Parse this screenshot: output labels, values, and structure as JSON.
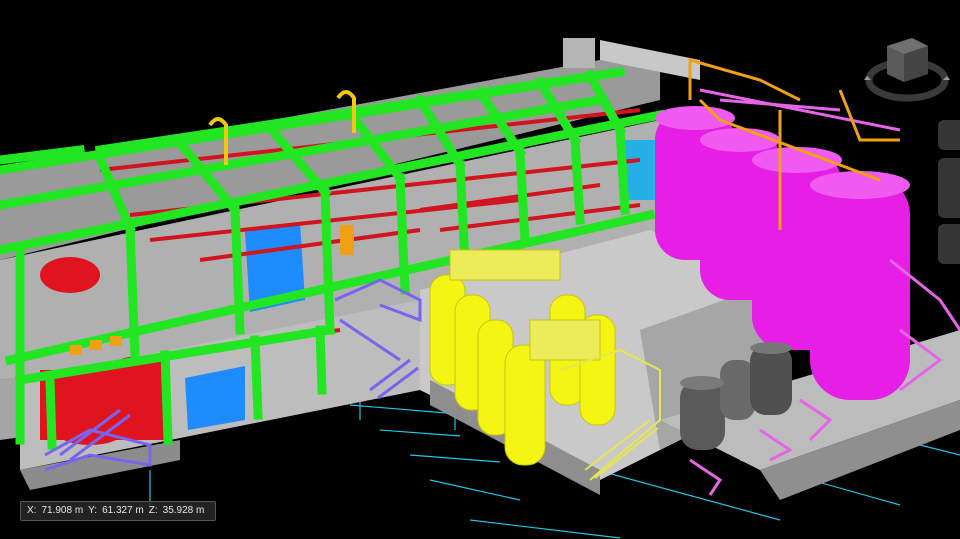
{
  "viewer": {
    "coordinates": {
      "x_label": "X:",
      "x_value": "71.908 m",
      "y_label": "Y:",
      "y_value": "61.327 m",
      "z_label": "Z:",
      "z_value": "35.928 m"
    },
    "icons": {
      "nav_cube": "view-cube-icon",
      "orbit_ring": "orbit-ring-icon",
      "tools": [
        "navigation-tool-icon",
        "zoom-tool-icon",
        "pan-tool-icon"
      ]
    }
  },
  "scene_colors": {
    "background": "#000000",
    "structural_steel": "#22e622",
    "large_tanks": "#e61ee6",
    "medium_tanks": "#f5f514",
    "dark_tanks": "#5a5a5a",
    "piping_red": "#d2141e",
    "equipment_blue": "#1e8cff",
    "stairs_violet": "#7864f0",
    "gridlines": "#1ec8e6",
    "floor_slab": "#b4b4b4"
  }
}
